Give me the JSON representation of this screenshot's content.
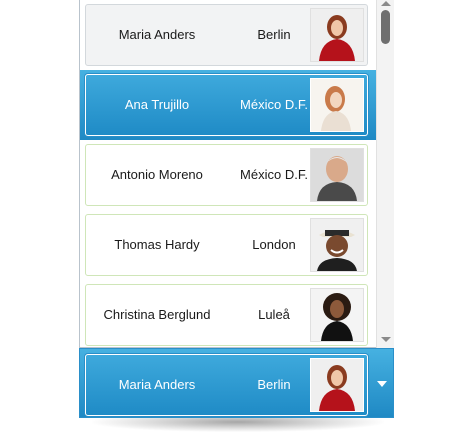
{
  "list": {
    "items": [
      {
        "name": "Maria Anders",
        "city": "Berlin",
        "photo_icon": "person-photo-icon"
      },
      {
        "name": "Ana Trujillo",
        "city": "México D.F.",
        "photo_icon": "person-photo-icon"
      },
      {
        "name": "Antonio Moreno",
        "city": "México D.F.",
        "photo_icon": "person-photo-icon"
      },
      {
        "name": "Thomas Hardy",
        "city": "London",
        "photo_icon": "person-photo-icon"
      },
      {
        "name": "Christina Berglund",
        "city": "Luleå",
        "photo_icon": "person-photo-icon"
      }
    ]
  },
  "combo": {
    "selected_name": "Maria Anders",
    "selected_city": "Berlin",
    "arrow_icon": "chevron-down-icon"
  },
  "colors": {
    "selection_top": "#46b1e1",
    "selection_bottom": "#1f89c4",
    "item_border": "#cfe6b8"
  }
}
